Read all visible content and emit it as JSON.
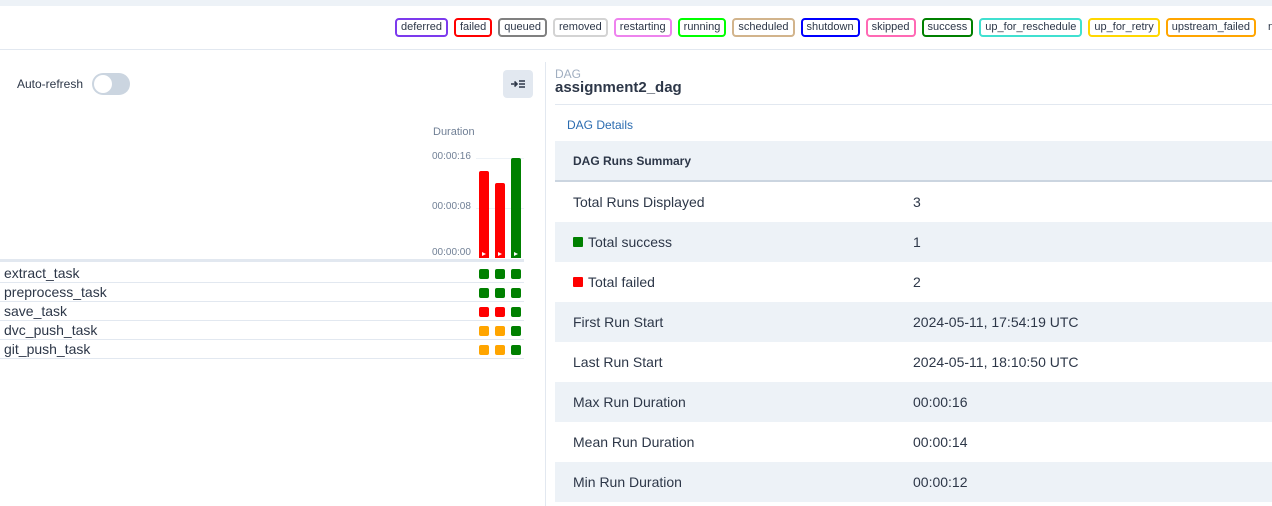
{
  "legend": [
    {
      "label": "deferred",
      "color": "#7c3aed"
    },
    {
      "label": "failed",
      "color": "#ff0000"
    },
    {
      "label": "queued",
      "color": "#808080"
    },
    {
      "label": "removed",
      "color": "#d3d3d3"
    },
    {
      "label": "restarting",
      "color": "#ee82ee"
    },
    {
      "label": "running",
      "color": "#00ff00"
    },
    {
      "label": "scheduled",
      "color": "#d2b48c"
    },
    {
      "label": "shutdown",
      "color": "#0000ff"
    },
    {
      "label": "skipped",
      "color": "#ff69b4"
    },
    {
      "label": "success",
      "color": "#008000"
    },
    {
      "label": "up_for_reschedule",
      "color": "#40e0d0"
    },
    {
      "label": "up_for_retry",
      "color": "#ffd700"
    },
    {
      "label": "upstream_failed",
      "color": "#ffa500"
    },
    {
      "label": "no_status",
      "color": ""
    }
  ],
  "sidebar": {
    "auto_refresh_label": "Auto-refresh",
    "auto_refresh_on": false
  },
  "duration_chart": {
    "title": "Duration",
    "ticks": [
      "00:00:16",
      "00:00:08",
      "00:00:00"
    ],
    "runs": [
      {
        "duration_sec": 14,
        "state": "failed",
        "color": "#ff0000"
      },
      {
        "duration_sec": 12,
        "state": "failed",
        "color": "#ff0000"
      },
      {
        "duration_sec": 16,
        "state": "success",
        "color": "#008000"
      }
    ]
  },
  "tasks": [
    {
      "name": "extract_task",
      "states": [
        "#008000",
        "#008000",
        "#008000"
      ]
    },
    {
      "name": "preprocess_task",
      "states": [
        "#008000",
        "#008000",
        "#008000"
      ]
    },
    {
      "name": "save_task",
      "states": [
        "#ff0000",
        "#ff0000",
        "#008000"
      ]
    },
    {
      "name": "dvc_push_task",
      "states": [
        "#ffa500",
        "#ffa500",
        "#008000"
      ]
    },
    {
      "name": "git_push_task",
      "states": [
        "#ffa500",
        "#ffa500",
        "#008000"
      ]
    }
  ],
  "dag": {
    "kicker": "DAG",
    "name": "assignment2_dag",
    "tab": "DAG Details",
    "summary_title": "DAG Runs Summary",
    "rows": [
      {
        "label": "Total Runs Displayed",
        "value": "3",
        "dot": ""
      },
      {
        "label": "Total success",
        "value": "1",
        "dot": "#008000"
      },
      {
        "label": "Total failed",
        "value": "2",
        "dot": "#ff0000"
      },
      {
        "label": "First Run Start",
        "value": "2024-05-11, 17:54:19 UTC",
        "dot": ""
      },
      {
        "label": "Last Run Start",
        "value": "2024-05-11, 18:10:50 UTC",
        "dot": ""
      },
      {
        "label": "Max Run Duration",
        "value": "00:00:16",
        "dot": ""
      },
      {
        "label": "Mean Run Duration",
        "value": "00:00:14",
        "dot": ""
      },
      {
        "label": "Min Run Duration",
        "value": "00:00:12",
        "dot": ""
      }
    ]
  }
}
